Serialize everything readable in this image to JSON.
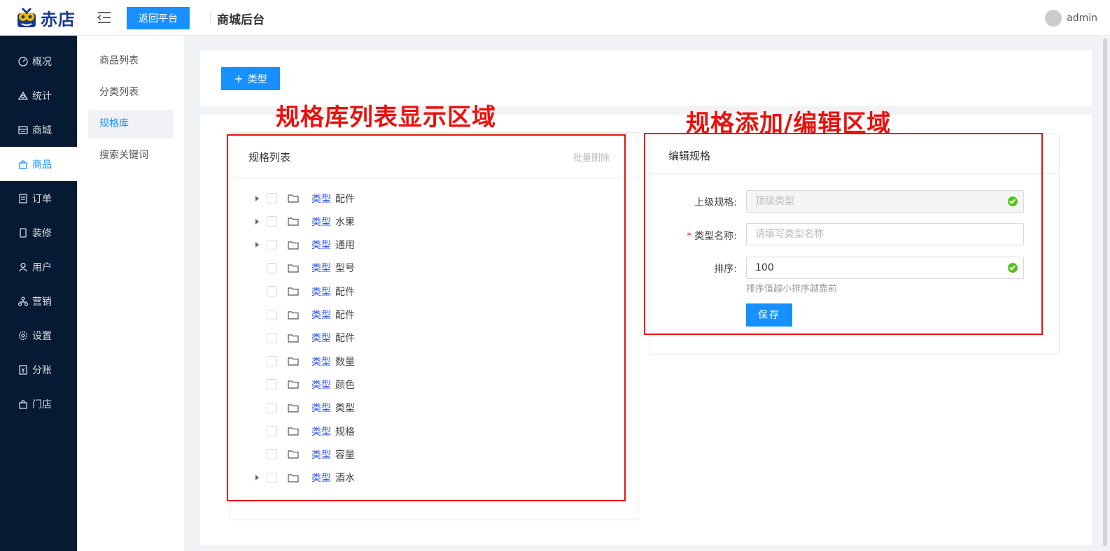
{
  "header": {
    "logo_text": "赤店",
    "back_button": "返回平台",
    "title": "商城后台",
    "user": "admin"
  },
  "sidebar": {
    "items": [
      {
        "label": "概况",
        "icon": "dashboard-icon"
      },
      {
        "label": "统计",
        "icon": "chart-icon"
      },
      {
        "label": "商城",
        "icon": "store-icon"
      },
      {
        "label": "商品",
        "icon": "bag-icon",
        "active": true
      },
      {
        "label": "订单",
        "icon": "order-icon"
      },
      {
        "label": "装修",
        "icon": "phone-icon"
      },
      {
        "label": "用户",
        "icon": "user-icon"
      },
      {
        "label": "营销",
        "icon": "marketing-icon"
      },
      {
        "label": "设置",
        "icon": "gear-icon"
      },
      {
        "label": "分账",
        "icon": "split-icon"
      },
      {
        "label": "门店",
        "icon": "shop-icon"
      }
    ]
  },
  "submenu": {
    "items": [
      {
        "label": "商品列表"
      },
      {
        "label": "分类列表"
      },
      {
        "label": "规格库",
        "active": true
      },
      {
        "label": "搜索关键词"
      }
    ]
  },
  "toolbar": {
    "add_label": "类型"
  },
  "annotations": {
    "list_area": "规格库列表显示区域",
    "edit_area": "规格添加/编辑区域"
  },
  "list": {
    "title": "规格列表",
    "batch_delete": "批量删除",
    "rows": [
      {
        "type": "类型",
        "name": "配件",
        "expandable": true
      },
      {
        "type": "类型",
        "name": "水果",
        "expandable": true
      },
      {
        "type": "类型",
        "name": "通用",
        "expandable": true
      },
      {
        "type": "类型",
        "name": "型号",
        "expandable": false
      },
      {
        "type": "类型",
        "name": "配件",
        "expandable": false
      },
      {
        "type": "类型",
        "name": "配件",
        "expandable": false
      },
      {
        "type": "类型",
        "name": "配件",
        "expandable": false
      },
      {
        "type": "类型",
        "name": "数量",
        "expandable": false
      },
      {
        "type": "类型",
        "name": "颜色",
        "expandable": false
      },
      {
        "type": "类型",
        "name": "类型",
        "expandable": false
      },
      {
        "type": "类型",
        "name": "规格",
        "expandable": false
      },
      {
        "type": "类型",
        "name": "容量",
        "expandable": false
      },
      {
        "type": "类型",
        "name": "酒水",
        "expandable": true
      }
    ]
  },
  "edit": {
    "title": "编辑规格",
    "parent_label": "上级规格:",
    "parent_value": "顶级类型",
    "name_label": "类型名称:",
    "name_placeholder": "请填写类型名称",
    "sort_label": "排序:",
    "sort_value": "100",
    "sort_hint": "排序值越小排序越靠前",
    "save_label": "保存"
  },
  "colors": {
    "primary": "#1890ff",
    "sidebar_bg": "#061a33",
    "annotation_red": "#e8120c",
    "success": "#52c41a"
  }
}
